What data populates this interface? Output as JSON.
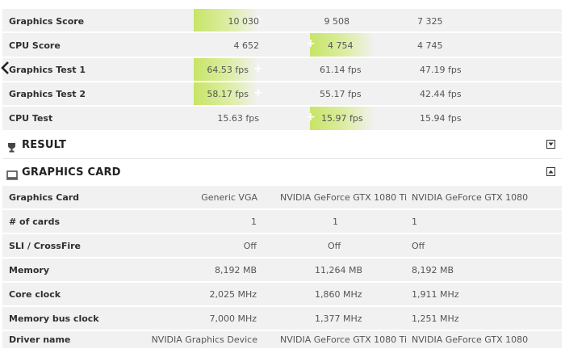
{
  "score_rows": [
    {
      "label": "Graphics Score",
      "v1": "10 030",
      "v2": "9 508",
      "v3": "7 325",
      "best": 1
    },
    {
      "label": "CPU Score",
      "v1": "4 652",
      "v2": "4 754",
      "v3": "4 745",
      "best": 2
    },
    {
      "label": "Graphics Test 1",
      "v1": "64.53 fps",
      "v2": "61.14 fps",
      "v3": "47.19 fps",
      "best": 1
    },
    {
      "label": "Graphics Test 2",
      "v1": "58.17 fps",
      "v2": "55.17 fps",
      "v3": "42.44 fps",
      "best": 1
    },
    {
      "label": "CPU Test",
      "v1": "15.63 fps",
      "v2": "15.97 fps",
      "v3": "15.94 fps",
      "best": 2
    }
  ],
  "result_section": {
    "title": "RESULT",
    "icon": "trophy-icon",
    "state": "collapsed"
  },
  "graphics_section": {
    "title": "GRAPHICS CARD",
    "icon": "monitor-icon",
    "state": "expanded"
  },
  "card_rows": [
    {
      "label": "Graphics Card",
      "v1": "Generic VGA",
      "v2": "NVIDIA GeForce GTX 1080 Ti",
      "v3": "NVIDIA GeForce GTX 1080"
    },
    {
      "label": "# of cards",
      "v1": "1",
      "v2": "1",
      "v3": "1"
    },
    {
      "label": "SLI / CrossFire",
      "v1": "Off",
      "v2": "Off",
      "v3": "Off"
    },
    {
      "label": "Memory",
      "v1": "8,192 MB",
      "v2": "11,264 MB",
      "v3": "8,192 MB"
    },
    {
      "label": "Core clock",
      "v1": "2,025 MHz",
      "v2": "1,860 MHz",
      "v3": "1,911 MHz"
    },
    {
      "label": "Memory bus clock",
      "v1": "7,000 MHz",
      "v2": "1,377 MHz",
      "v3": "1,251 MHz"
    },
    {
      "label": "Driver name",
      "v1": "NVIDIA Graphics Device",
      "v2": "NVIDIA GeForce GTX 1080 Ti",
      "v3": "NVIDIA GeForce GTX 1080"
    }
  ],
  "highlight_color": "#c5e45f",
  "back_icon": "chevron-left-icon"
}
